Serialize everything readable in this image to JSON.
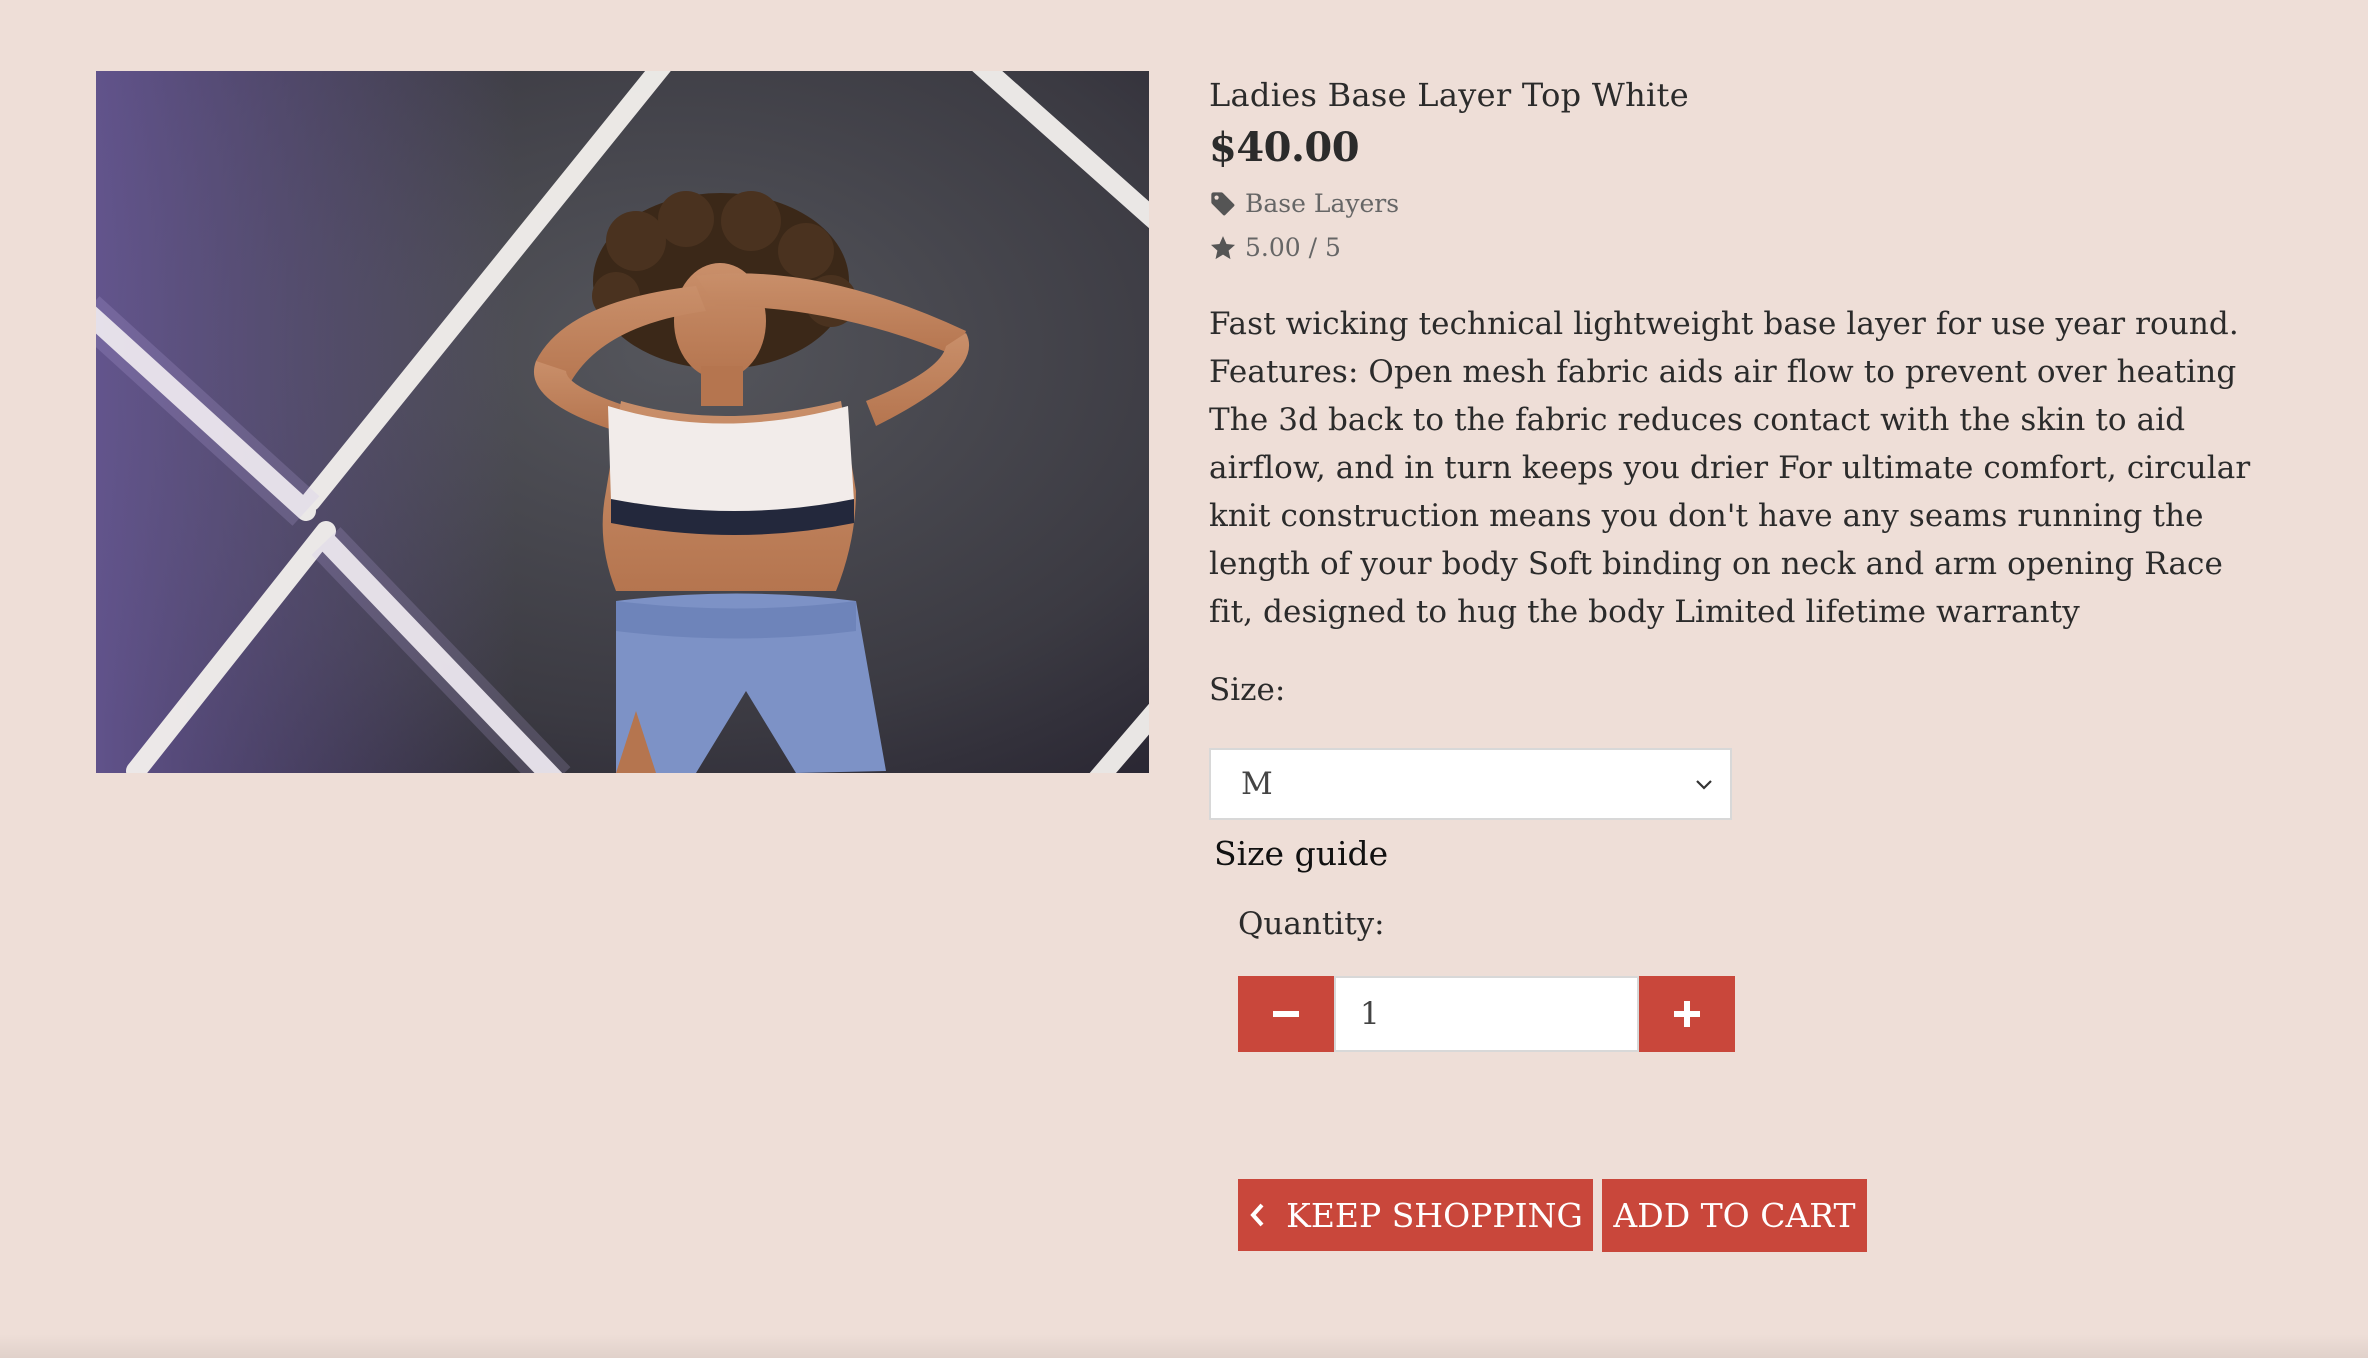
{
  "product": {
    "name": "Ladies Base Layer Top White",
    "price": "$40.00",
    "category": "Base Layers",
    "rating": "5.00 / 5",
    "description": "Fast wicking technical lightweight base layer for use year round. Features: Open mesh fabric aids air flow to prevent over heating The 3d back to the fabric reduces contact with the skin to aid airflow, and in turn keeps you drier For ultimate comfort, circular knit construction means you don't have any seams running the length of your body Soft binding on neck and arm opening Race fit, designed to hug the body Limited lifetime warranty"
  },
  "size": {
    "label": "Size:",
    "selected": "M",
    "guide_label": "Size guide"
  },
  "quantity": {
    "label": "Quantity:",
    "value": "1"
  },
  "actions": {
    "keep_shopping_label": "KEEP SHOPPING",
    "add_to_cart_label": "ADD TO CART"
  },
  "icons": {
    "category": "tag-icon",
    "rating": "star-icon",
    "decrement": "minus-icon",
    "increment": "plus-icon",
    "back": "chevron-left-icon",
    "dropdown": "chevron-down-icon"
  },
  "colors": {
    "background": "#eeded7",
    "accent": "#c9473b",
    "text": "#2b2b2b",
    "muted": "#666666"
  }
}
